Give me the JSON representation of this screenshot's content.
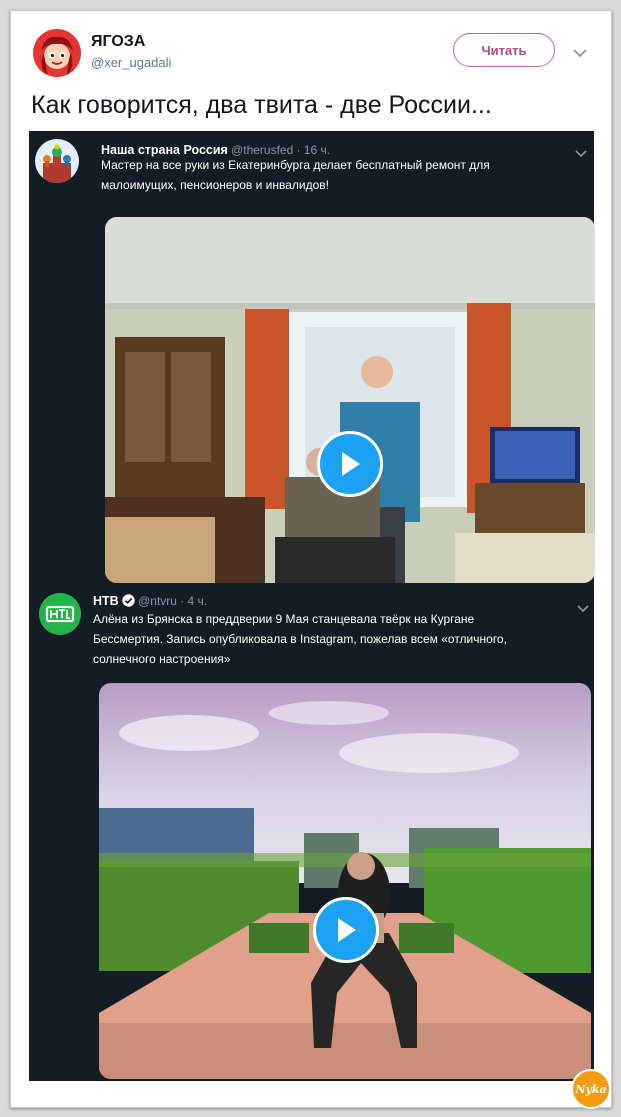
{
  "tweet": {
    "author_name": "ЯГОЗА",
    "author_handle": "@xer_ugadali",
    "follow_label": "Читать",
    "text": "Как говорится, два твита - две России..."
  },
  "embedded": [
    {
      "name": "Наша страна Россия",
      "handle": "@therusfed",
      "time": "· 16 ч.",
      "lines": [
        "Мастер на все руки из Екатеринбурга делает бесплатный ремонт для",
        "малоимущих, пенсионеров и инвалидов!"
      ]
    },
    {
      "name": "НТВ",
      "handle": "@ntvru",
      "time": "· 4 ч.",
      "lines": [
        "Алёна из Брянска в преддверии 9 Мая станцевала твёрк на Кургане",
        "Бессмертия. Запись опубликовала в Instagram, пожелав всем «отличного,",
        "солнечного настроения»"
      ]
    }
  ],
  "watermark": "Nyka",
  "colors": {
    "accent": "#1da1f2",
    "follow": "#b0478f",
    "embed_bg": "#141d26"
  }
}
